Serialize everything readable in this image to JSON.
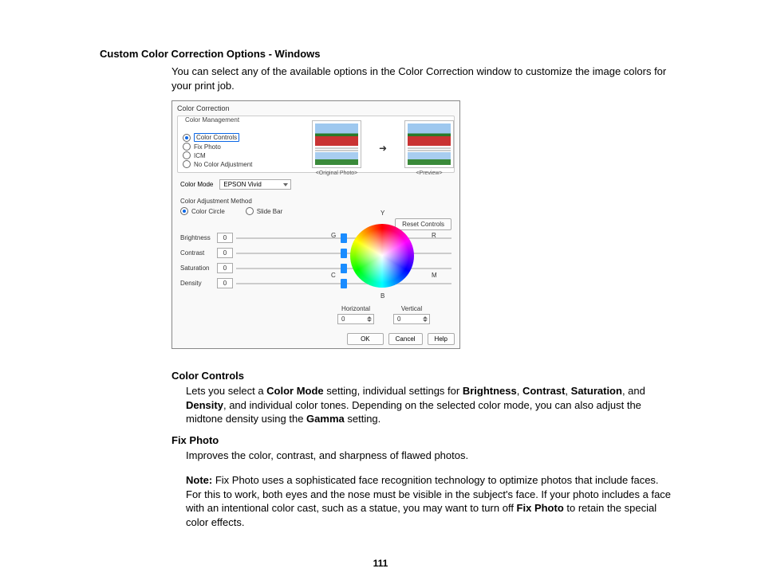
{
  "page_number": "111",
  "heading": "Custom Color Correction Options - Windows",
  "intro": "You can select any of the available options in the Color Correction window to customize the image colors for your print job.",
  "dialog": {
    "title": "Color Correction",
    "group_mgmt": "Color Management",
    "opt_controls": "Color Controls",
    "opt_fix": "Fix Photo",
    "opt_icm": "ICM",
    "opt_none": "No Color Adjustment",
    "mode_label": "Color Mode",
    "mode_value": "EPSON Vivid",
    "adj_method": "Color Adjustment Method",
    "adj_circle": "Color Circle",
    "adj_slide": "Slide Bar",
    "reset_btn": "Reset Controls",
    "sliders": {
      "brightness": "Brightness",
      "contrast": "Contrast",
      "saturation": "Saturation",
      "density": "Density",
      "val": "0"
    },
    "orig_caption": "<Original Photo>",
    "prev_caption": "<Preview>",
    "lbl_y": "Y",
    "lbl_g": "G",
    "lbl_r": "R",
    "lbl_c": "C",
    "lbl_m": "M",
    "lbl_b": "B",
    "horiz": "Horizontal",
    "vert": "Vertical",
    "hv_val": "0",
    "ok": "OK",
    "cancel": "Cancel",
    "help": "Help"
  },
  "sec1_title": "Color Controls",
  "sec1_t1": "Lets you select a ",
  "sec1_b1": "Color Mode",
  "sec1_t2": " setting, individual settings for ",
  "sec1_b2": "Brightness",
  "sec1_c1": ", ",
  "sec1_b3": "Contrast",
  "sec1_c2": ", ",
  "sec1_b4": "Saturation",
  "sec1_t3": ", and ",
  "sec1_b5": "Density",
  "sec1_t4": ", and individual color tones. Depending on the selected color mode, you can also adjust the midtone density using the ",
  "sec1_b6": "Gamma",
  "sec1_t5": " setting.",
  "sec2_title": "Fix Photo",
  "sec2_body": "Improves the color, contrast, and sharpness of flawed photos.",
  "note_b1": "Note:",
  "note_t1": " Fix Photo uses a sophisticated face recognition technology to optimize photos that include faces. For this to work, both eyes and the nose must be visible in the subject's face. If your photo includes a face with an intentional color cast, such as a statue, you may want to turn off ",
  "note_b2": "Fix Photo",
  "note_t2": " to retain the special color effects."
}
